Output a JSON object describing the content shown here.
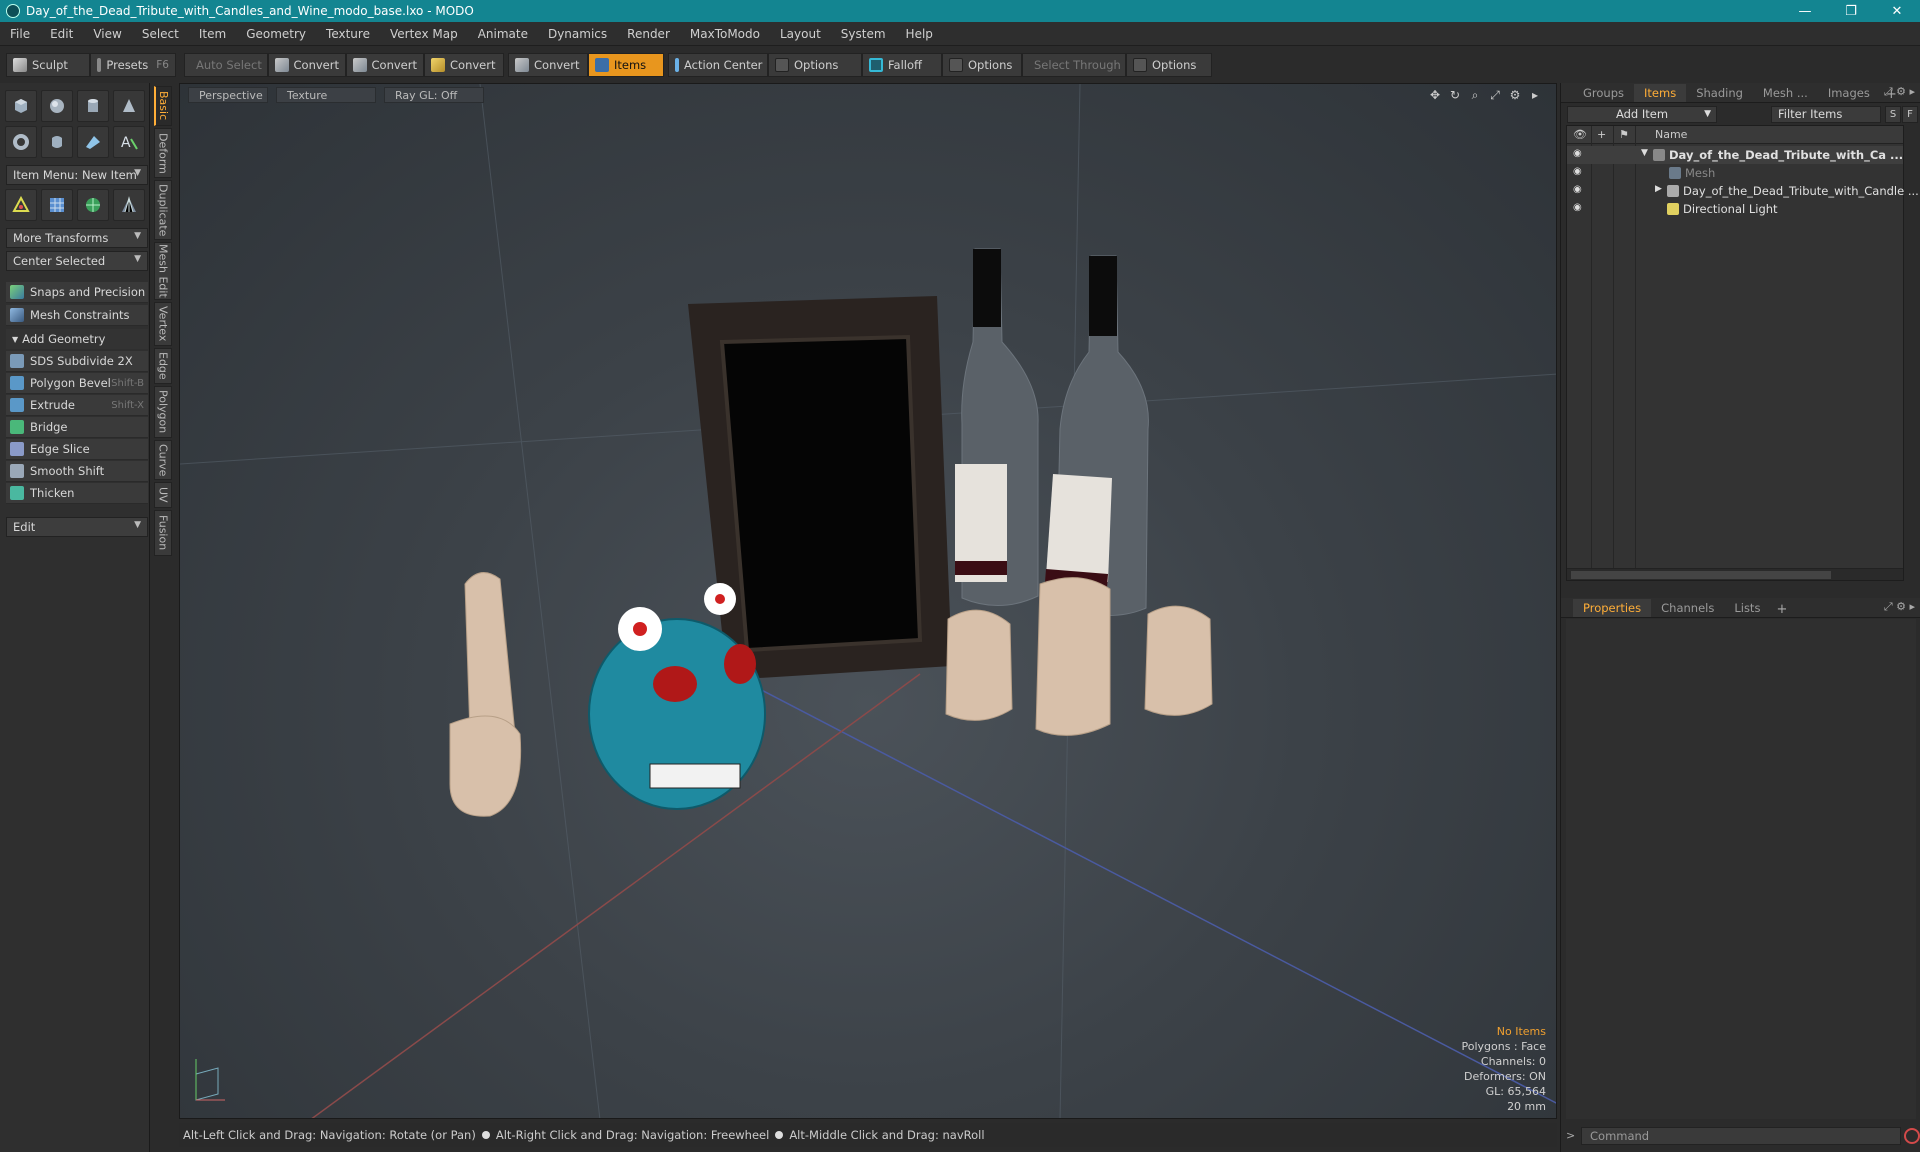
{
  "window": {
    "title": "Day_of_the_Dead_Tribute_with_Candles_and_Wine_modo_base.lxo - MODO",
    "minimize": "—",
    "maximize": "❐",
    "close": "✕",
    "accent": "#138591"
  },
  "menu": [
    "File",
    "Edit",
    "View",
    "Select",
    "Item",
    "Geometry",
    "Texture",
    "Vertex Map",
    "Animate",
    "Dynamics",
    "Render",
    "MaxToModo",
    "Layout",
    "System",
    "Help"
  ],
  "toolbar": {
    "sculpt": "Sculpt",
    "presets": "Presets",
    "presets_key": "F6",
    "auto_select": "Auto Select",
    "convert1": "Convert",
    "convert2": "Convert",
    "convert3": "Convert",
    "convert4": "Convert",
    "items": "Items",
    "action_center": "Action Center",
    "options1": "Options",
    "falloff": "Falloff",
    "options2": "Options",
    "select_through": "Select Through",
    "options3": "Options",
    "active_color": "#e8961e"
  },
  "left": {
    "item_menu": "Item Menu: New Item",
    "more_transforms": "More Transforms",
    "center_selected": "Center Selected",
    "snaps": "Snaps and Precision",
    "mesh_constraints": "Mesh Constraints",
    "add_geometry": "Add Geometry",
    "tools": [
      {
        "label": "SDS Subdivide 2X",
        "shortcut": ""
      },
      {
        "label": "Polygon Bevel",
        "shortcut": "Shift-B"
      },
      {
        "label": "Extrude",
        "shortcut": "Shift-X"
      },
      {
        "label": "Bridge",
        "shortcut": ""
      },
      {
        "label": "Edge Slice",
        "shortcut": ""
      },
      {
        "label": "Smooth Shift",
        "shortcut": ""
      },
      {
        "label": "Thicken",
        "shortcut": ""
      }
    ],
    "edit": "Edit",
    "vtabs": [
      "Basic",
      "Deform",
      "Duplicate",
      "Mesh Edit",
      "Vertex",
      "Edge",
      "Polygon",
      "Curve",
      "UV",
      "Fusion"
    ]
  },
  "viewport": {
    "view": "Perspective",
    "shading": "Texture",
    "raygl": "Ray GL: Off",
    "info": {
      "no_items": "No Items",
      "polygons": "Polygons : Face",
      "channels": "Channels: 0",
      "deformers": "Deformers: ON",
      "gl": "GL: 65,564",
      "scale": "20 mm"
    }
  },
  "status": {
    "hint1": "Alt-Left Click and Drag: Navigation: Rotate (or Pan)",
    "hint2": "Alt-Right Click and Drag: Navigation: Freewheel",
    "hint3": "Alt-Middle Click and Drag: navRoll"
  },
  "right": {
    "tabs": [
      "Groups",
      "Items",
      "Shading",
      "Mesh ...",
      "Images"
    ],
    "add_item": "Add Item",
    "filter": "Filter Items",
    "s": "S",
    "f": "F",
    "col_name": "Name",
    "tree": [
      {
        "label": "Day_of_the_Dead_Tribute_with_Ca ...",
        "level": 0
      },
      {
        "label": "Mesh",
        "level": 1
      },
      {
        "label": "Day_of_the_Dead_Tribute_with_Candle ...",
        "level": 1
      },
      {
        "label": "Directional Light",
        "level": 1
      }
    ],
    "bottom_tabs": [
      "Properties",
      "Channels",
      "Lists"
    ],
    "command": "Command"
  }
}
